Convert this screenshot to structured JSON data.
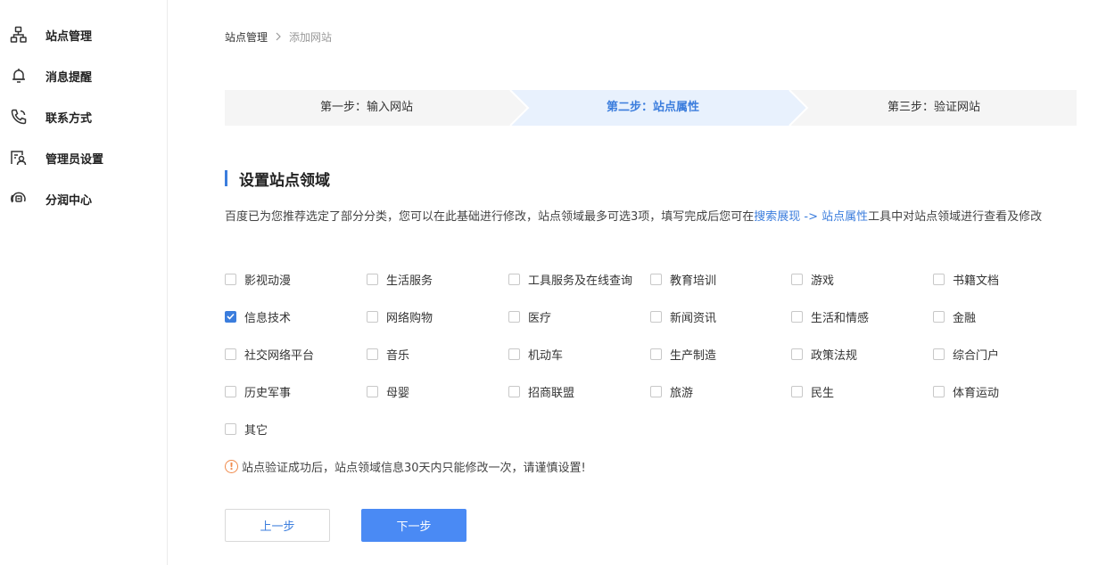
{
  "sidebar": {
    "items": [
      {
        "label": "站点管理",
        "icon": "sitemap-icon"
      },
      {
        "label": "消息提醒",
        "icon": "bell-icon"
      },
      {
        "label": "联系方式",
        "icon": "phone-icon"
      },
      {
        "label": "管理员设置",
        "icon": "admin-icon"
      },
      {
        "label": "分润中心",
        "icon": "revenue-icon"
      }
    ]
  },
  "breadcrumb": {
    "root": "站点管理",
    "separator": ">",
    "current": "添加网站"
  },
  "steps": [
    {
      "label": "第一步：输入网站",
      "active": false
    },
    {
      "label": "第二步：站点属性",
      "active": true
    },
    {
      "label": "第三步：验证网站",
      "active": false
    }
  ],
  "section": {
    "title": "设置站点领域",
    "desc_pre": "百度已为您推荐选定了部分分类，您可以在此基础进行修改，站点领域最多可选3项，填写完成后您可在",
    "desc_link": "搜索展现 -> 站点属性",
    "desc_post": "工具中对站点领域进行查看及修改"
  },
  "categories": [
    {
      "label": "影视动漫",
      "checked": false
    },
    {
      "label": "生活服务",
      "checked": false
    },
    {
      "label": "工具服务及在线查询",
      "checked": false
    },
    {
      "label": "教育培训",
      "checked": false
    },
    {
      "label": "游戏",
      "checked": false
    },
    {
      "label": "书籍文档",
      "checked": false
    },
    {
      "label": "信息技术",
      "checked": true
    },
    {
      "label": "网络购物",
      "checked": false
    },
    {
      "label": "医疗",
      "checked": false
    },
    {
      "label": "新闻资讯",
      "checked": false
    },
    {
      "label": "生活和情感",
      "checked": false
    },
    {
      "label": "金融",
      "checked": false
    },
    {
      "label": "社交网络平台",
      "checked": false
    },
    {
      "label": "音乐",
      "checked": false
    },
    {
      "label": "机动车",
      "checked": false
    },
    {
      "label": "生产制造",
      "checked": false
    },
    {
      "label": "政策法规",
      "checked": false
    },
    {
      "label": "综合门户",
      "checked": false
    },
    {
      "label": "历史军事",
      "checked": false
    },
    {
      "label": "母婴",
      "checked": false
    },
    {
      "label": "招商联盟",
      "checked": false
    },
    {
      "label": "旅游",
      "checked": false
    },
    {
      "label": "民生",
      "checked": false
    },
    {
      "label": "体育运动",
      "checked": false
    },
    {
      "label": "其它",
      "checked": false
    }
  ],
  "warning": {
    "icon": "!",
    "text": "站点验证成功后，站点领域信息30天内只能修改一次，请谨慎设置!"
  },
  "buttons": {
    "prev": "上一步",
    "next": "下一步"
  },
  "colors": {
    "accent": "#3b7ddd",
    "primary_button": "#4a8af4",
    "step_active_bg": "#e8f1fd",
    "step_bg": "#f5f5f5",
    "warning": "#f08a4b"
  }
}
